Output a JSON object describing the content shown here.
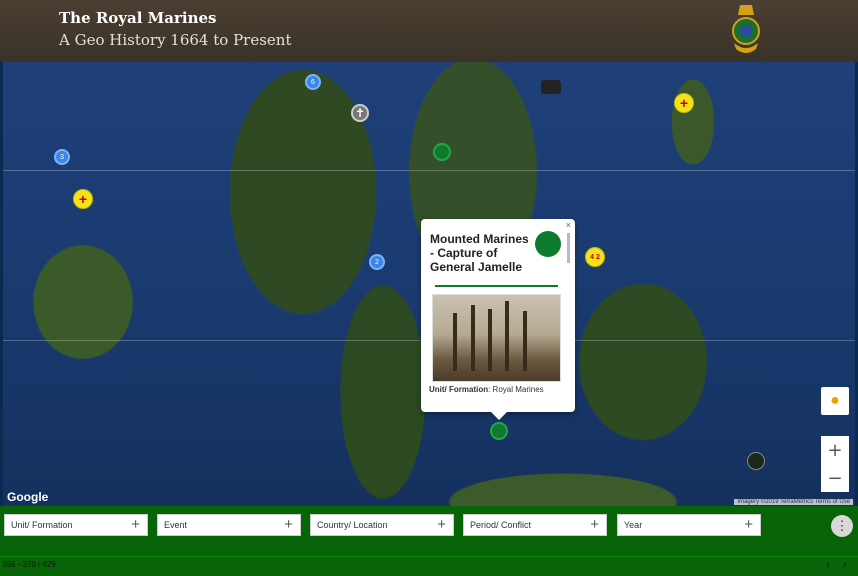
{
  "header": {
    "title": "The Royal Marines",
    "subtitle": "A Geo History 1664 to Present"
  },
  "map": {
    "markers": [
      {
        "type": "blue",
        "label": "6"
      },
      {
        "type": "blue",
        "label": "3"
      },
      {
        "type": "blue",
        "label": "2"
      },
      {
        "type": "yellow",
        "label": "+"
      },
      {
        "type": "yellow",
        "label": "+"
      },
      {
        "type": "yellow",
        "label": "4 2"
      },
      {
        "type": "green",
        "label": ""
      },
      {
        "type": "green",
        "label": ""
      },
      {
        "type": "grey",
        "label": "✝"
      }
    ],
    "google_logo": "Google",
    "attribution": "Imagery ©2019 TerraMetrics   Terms of Use",
    "zoom_in": "+",
    "zoom_out": "−",
    "pegman_icon": "pegman-icon"
  },
  "popup": {
    "title": "Mounted Marines - Capture of General Jamelle",
    "close": "×",
    "unit_label": "Unit/ Formation",
    "unit_value": ": Royal Marines"
  },
  "filters": [
    {
      "label": "Unit/ Formation",
      "action": "+"
    },
    {
      "label": "Event",
      "action": "+"
    },
    {
      "label": "Country/ Location",
      "action": "+"
    },
    {
      "label": "Period/ Conflict",
      "action": "+"
    },
    {
      "label": "Year",
      "action": "+"
    }
  ],
  "menu_icon": "⋮",
  "status": {
    "count": "366 - 370 / 429",
    "prev": "‹",
    "next": "›"
  },
  "colors": {
    "header_bg": "#3a3228",
    "bar_green": "#076507",
    "marker_blue": "#3a86e8",
    "marker_green": "#0e7a2e",
    "marker_yellow": "#f4e21a"
  }
}
